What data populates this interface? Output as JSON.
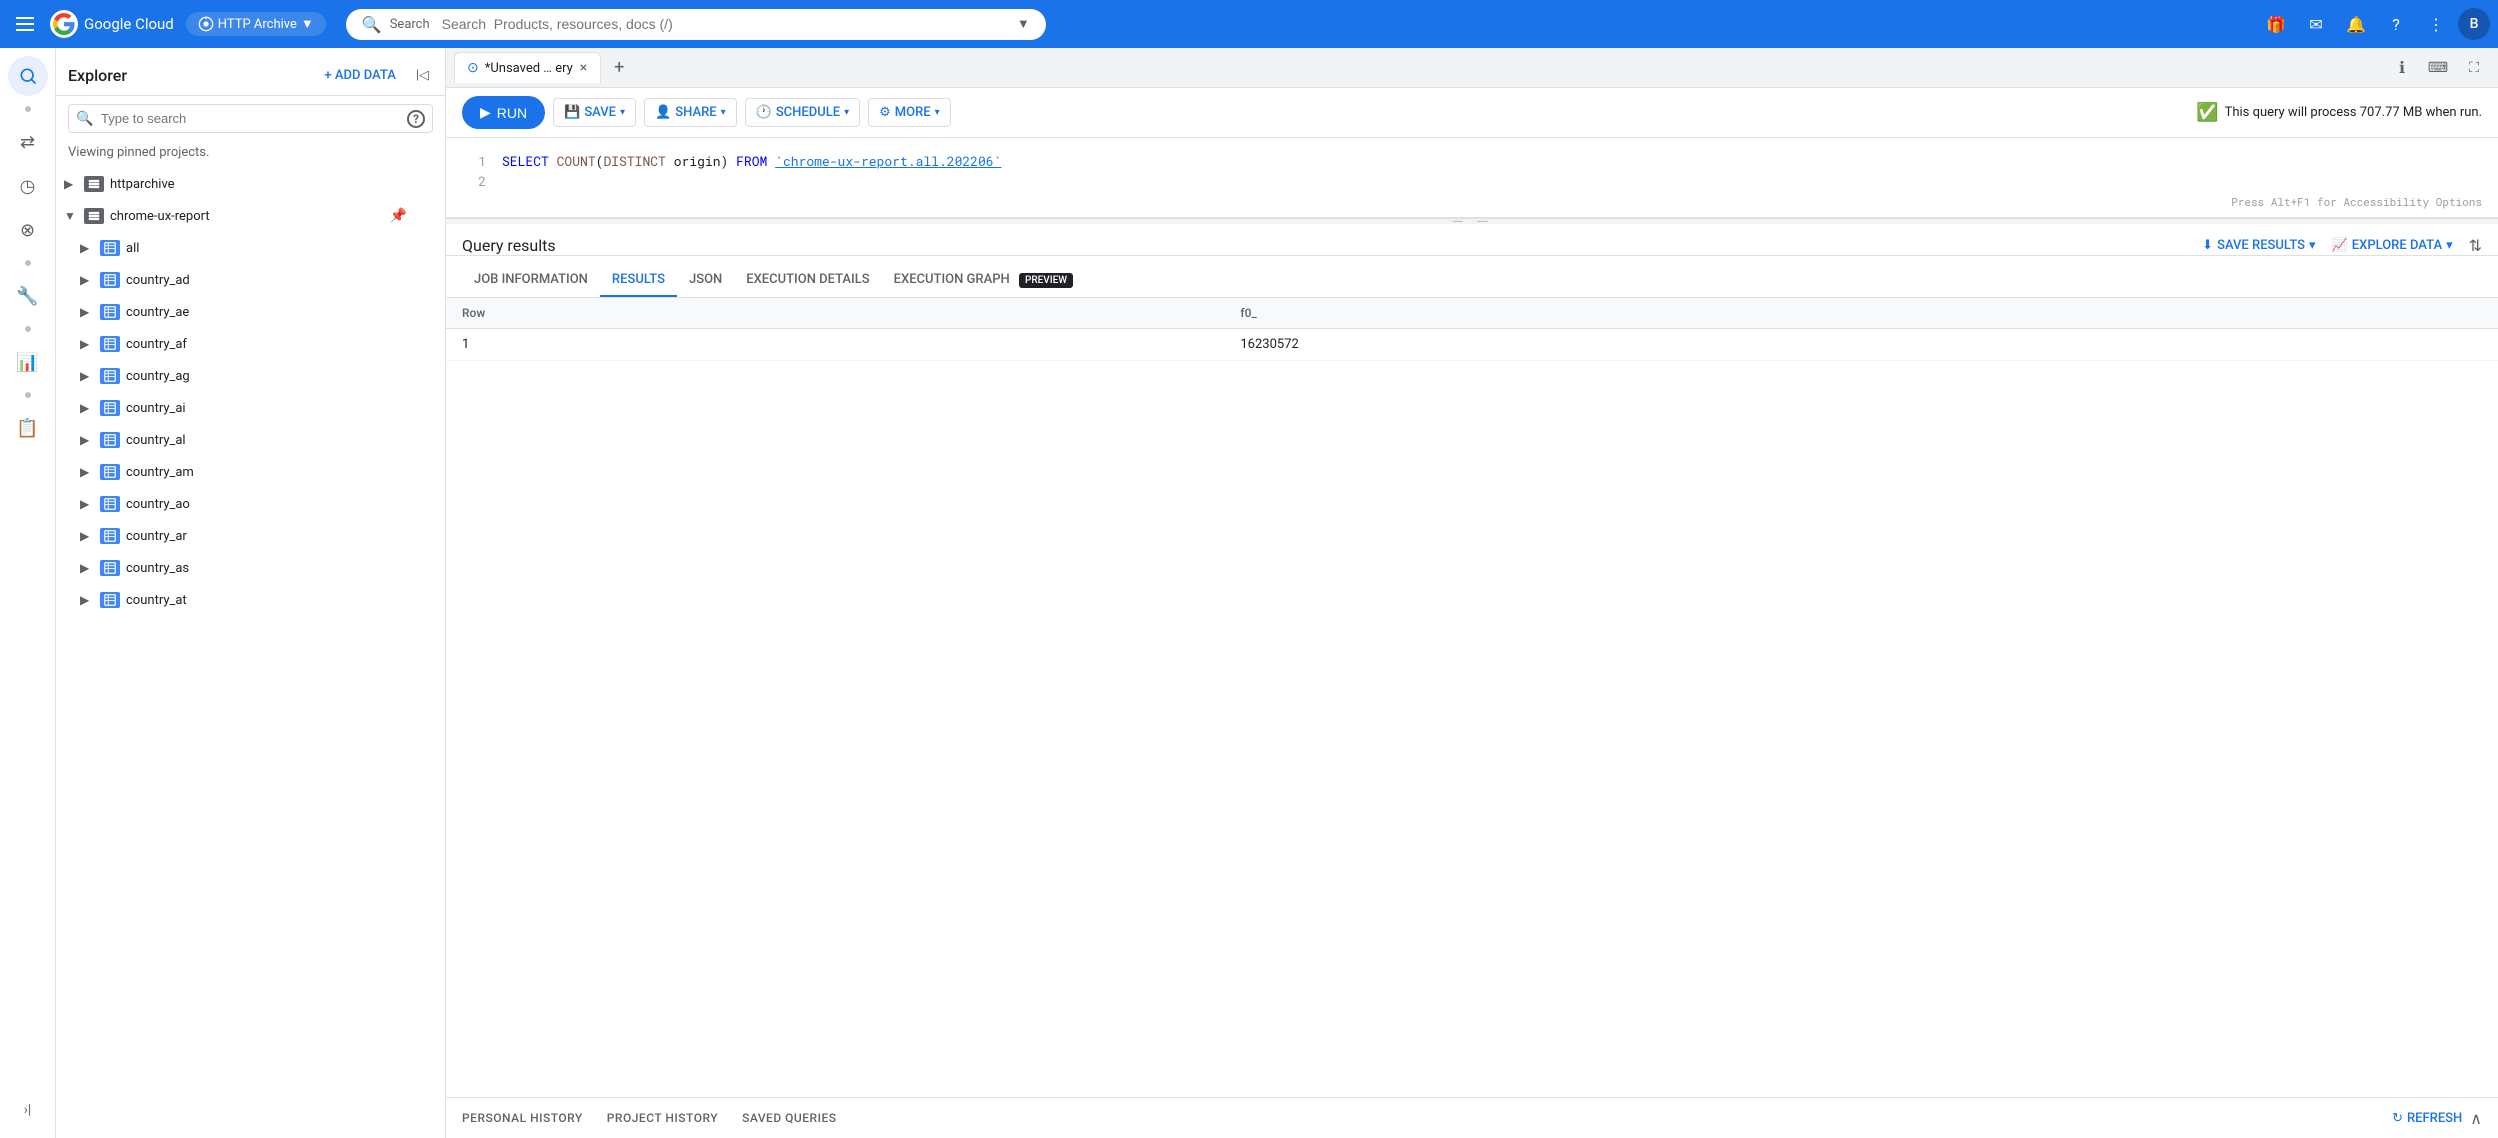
{
  "topNav": {
    "hamburger_label": "Menu",
    "logo_text": "Google Cloud",
    "logo_inner": "GC",
    "project_name": "HTTP Archive",
    "search_placeholder": "Search  Products, resources, docs (/)",
    "expand_icon": "▼",
    "avatar_text": "B"
  },
  "iconSidebar": {
    "icons": [
      "⊙",
      "⇄",
      "◷",
      "⊗",
      "·",
      "🔧",
      "·",
      "📊",
      "·",
      "📋"
    ]
  },
  "explorer": {
    "title": "Explorer",
    "add_data_label": "+ ADD DATA",
    "collapse_icon": "⟨|",
    "search_placeholder": "Type to search",
    "viewing_text": "Viewing pinned projects.",
    "items": [
      {
        "id": "httparchive",
        "label": "httparchive",
        "level": 0,
        "expanded": false,
        "has_icon": true
      },
      {
        "id": "chrome-ux-report",
        "label": "chrome-ux-report",
        "level": 0,
        "expanded": true,
        "has_icon": true,
        "pinned": true
      },
      {
        "id": "all",
        "label": "all",
        "level": 1,
        "expanded": false,
        "has_icon": true
      },
      {
        "id": "country_ad",
        "label": "country_ad",
        "level": 1,
        "expanded": false,
        "has_icon": true
      },
      {
        "id": "country_ae",
        "label": "country_ae",
        "level": 1,
        "expanded": false,
        "has_icon": true
      },
      {
        "id": "country_af",
        "label": "country_af",
        "level": 1,
        "expanded": false,
        "has_icon": true
      },
      {
        "id": "country_ag",
        "label": "country_ag",
        "level": 1,
        "expanded": false,
        "has_icon": true
      },
      {
        "id": "country_ai",
        "label": "country_ai",
        "level": 1,
        "expanded": false,
        "has_icon": true
      },
      {
        "id": "country_al",
        "label": "country_al",
        "level": 1,
        "expanded": false,
        "has_icon": true
      },
      {
        "id": "country_am",
        "label": "country_am",
        "level": 1,
        "expanded": false,
        "has_icon": true
      },
      {
        "id": "country_ao",
        "label": "country_ao",
        "level": 1,
        "expanded": false,
        "has_icon": true
      },
      {
        "id": "country_ar",
        "label": "country_ar",
        "level": 1,
        "expanded": false,
        "has_icon": true
      },
      {
        "id": "country_as",
        "label": "country_as",
        "level": 1,
        "expanded": false,
        "has_icon": true
      },
      {
        "id": "country_at",
        "label": "country_at",
        "level": 1,
        "expanded": false,
        "has_icon": true
      }
    ]
  },
  "queryTab": {
    "icon": "⊙",
    "label": "*Unsaved … ery",
    "close_icon": "×"
  },
  "toolbar": {
    "run_label": "RUN",
    "save_label": "SAVE",
    "share_label": "SHARE",
    "schedule_label": "SCHEDULE",
    "more_label": "MORE",
    "query_info": "This query will process 707.77 MB when run."
  },
  "codeEditor": {
    "lines": [
      {
        "num": "1",
        "content": "SELECT COUNT(DISTINCT origin) FROM `chrome-ux-report.all.202206`"
      },
      {
        "num": "2",
        "content": ""
      }
    ],
    "accessibility_hint": "Press Alt+F1 for Accessibility Options"
  },
  "queryResults": {
    "title": "Query results",
    "save_results_label": "SAVE RESULTS",
    "explore_data_label": "EXPLORE DATA",
    "tabs": [
      {
        "id": "job-info",
        "label": "JOB INFORMATION",
        "active": false
      },
      {
        "id": "results",
        "label": "RESULTS",
        "active": true
      },
      {
        "id": "json",
        "label": "JSON",
        "active": false
      },
      {
        "id": "execution-details",
        "label": "EXECUTION DETAILS",
        "active": false
      },
      {
        "id": "execution-graph",
        "label": "EXECUTION GRAPH",
        "active": false,
        "badge": "PREVIEW"
      }
    ],
    "table": {
      "columns": [
        "Row",
        "f0_"
      ],
      "rows": [
        {
          "row": "1",
          "f0_": "16230572"
        }
      ]
    }
  },
  "bottomBar": {
    "tabs": [
      {
        "id": "personal-history",
        "label": "PERSONAL HISTORY"
      },
      {
        "id": "project-history",
        "label": "PROJECT HISTORY"
      },
      {
        "id": "saved-queries",
        "label": "SAVED QUERIES"
      }
    ],
    "refresh_label": "REFRESH",
    "collapse_icon": "∧"
  }
}
